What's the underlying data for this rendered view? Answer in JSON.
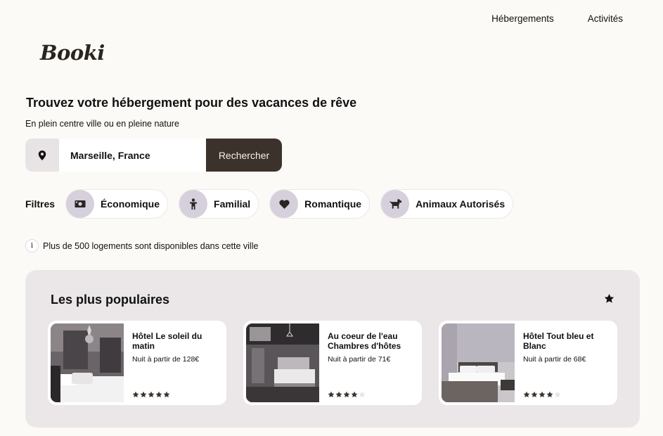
{
  "nav": {
    "items": [
      "Hébergements",
      "Activités"
    ]
  },
  "logo": "Booki",
  "hero": {
    "title": "Trouvez votre hébergement pour des vacances de rêve",
    "subtitle": "En plein centre ville ou en pleine nature"
  },
  "search": {
    "value": "Marseille, France",
    "button": "Rechercher",
    "icon": "location-pin-icon"
  },
  "filters": {
    "label": "Filtres",
    "items": [
      {
        "label": "Économique",
        "icon": "money-icon"
      },
      {
        "label": "Familial",
        "icon": "child-icon"
      },
      {
        "label": "Romantique",
        "icon": "heart-icon"
      },
      {
        "label": "Animaux Autorisés",
        "icon": "dog-icon"
      }
    ]
  },
  "info": {
    "icon": "info-icon",
    "text": "Plus de 500 logements sont disponibles dans cette ville"
  },
  "popular": {
    "title": "Les plus populaires",
    "icon": "star-icon",
    "cards": [
      {
        "name": "Hôtel Le soleil du matin",
        "price": "Nuit à partir de 128€",
        "rating": 5
      },
      {
        "name": "Au coeur de l'eau Chambres d'hôtes",
        "price": "Nuit à partir de 71€",
        "rating": 4
      },
      {
        "name": "Hôtel Tout bleu et Blanc",
        "price": "Nuit à partir de 68€",
        "rating": 4
      }
    ]
  },
  "colors": {
    "background": "#fbfaf7",
    "accent": "#3b332b",
    "chip_icon_bg": "#d6d0dc",
    "panel": "#ebe7e8"
  }
}
